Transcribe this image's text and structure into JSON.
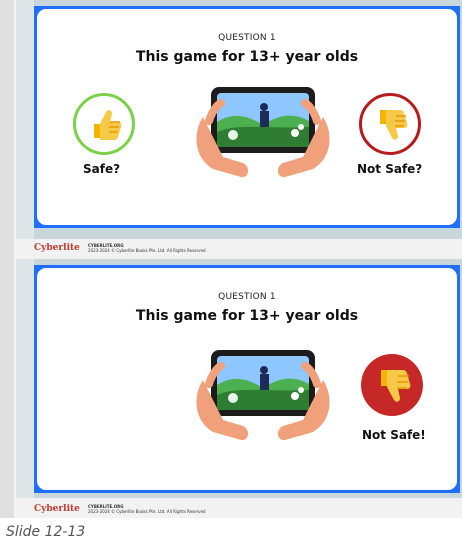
{
  "slides": [
    {
      "question": "QUESTION 1",
      "title": "This game for 13+ year olds",
      "safe_label": "Safe?",
      "not_safe_label": "Not Safe?",
      "safe_color": "#7cd14a",
      "not_safe_color": "#b71c1c",
      "footer_logo": "Cyberlite",
      "footer_line1": "CYBERLITE.ORG",
      "footer_line2": "2023-2024 © Cyberlite Books Pte. Ltd. All Rights Reserved"
    },
    {
      "question": "QUESTION 1",
      "title": "This game for 13+ year olds",
      "not_safe_label": "Not Safe!",
      "not_safe_color": "#c62828",
      "footer_logo": "Cyberlite",
      "footer_line1": "CYBERLITE.ORG",
      "footer_line2": "2023-2024 © Cyberlite Books Pte. Ltd. All Rights Reserved"
    }
  ],
  "caption": "Slide 12-13",
  "icons": {
    "thumbs_up": "thumbs-up-icon",
    "thumbs_down": "thumbs-down-icon",
    "phone_game": "phone-game-illustration"
  }
}
